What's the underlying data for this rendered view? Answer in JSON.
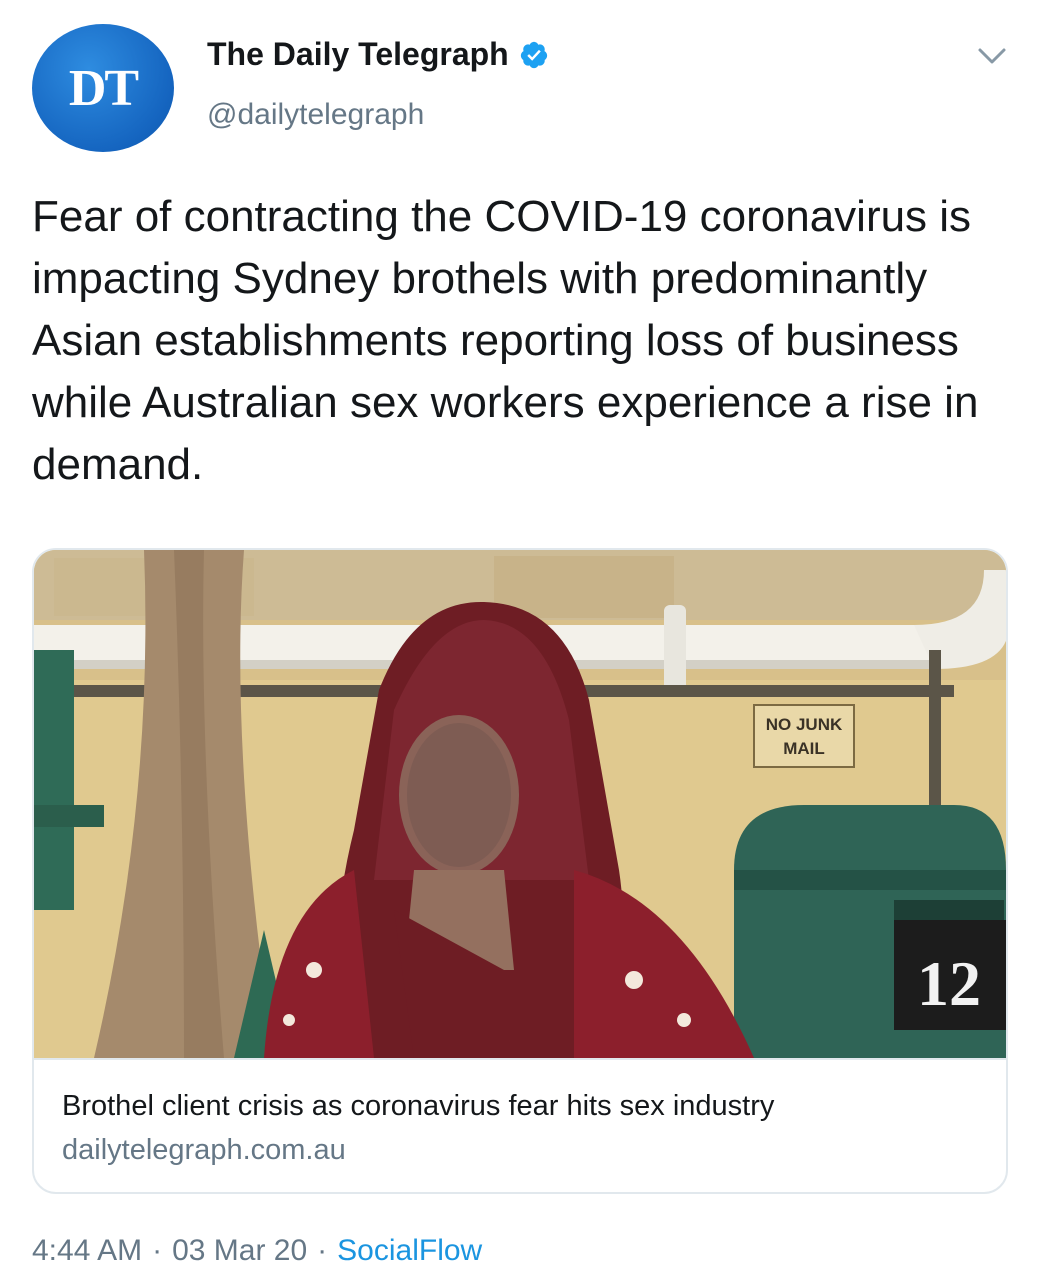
{
  "author": {
    "avatar_text": "DT",
    "display_name": "The Daily Telegraph",
    "handle": "@dailytelegraph",
    "verified": true
  },
  "tweet": {
    "text": "Fear of contracting the COVID-19 coronavirus is impacting Sydney brothels with predominantly Asian establishments reporting loss of business while Australian sex workers experience a rise in demand."
  },
  "card": {
    "title": "Brothel client crisis as coronavirus fear hits sex industry",
    "domain": "dailytelegraph.com.au",
    "image_signs": {
      "sign_line1": "NO JUNK",
      "sign_line2": "MAIL",
      "mailbox_number": "12"
    }
  },
  "footer": {
    "time": "4:44 AM",
    "sep1": "·",
    "date": "03 Mar 20",
    "sep2": "·",
    "source": "SocialFlow"
  },
  "colors": {
    "accent": "#1b95e0",
    "avatar_blue": "#1565c0",
    "secondary_text": "#657786",
    "border": "#e1e8ed"
  }
}
